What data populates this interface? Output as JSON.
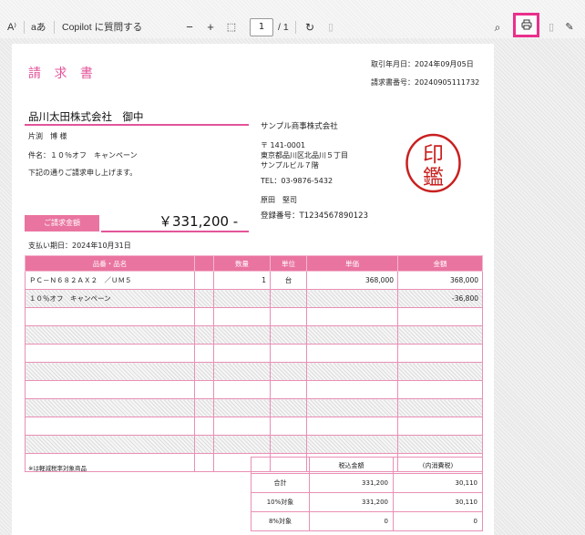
{
  "toolbar": {
    "read_aloud_icon": "A⁾",
    "text_label": "aあ",
    "copilot_label": "Copilot に質問する",
    "zoom_out": "−",
    "zoom_in": "+",
    "fit_icon": "⬚",
    "page_current": "1",
    "page_total": "/ 1",
    "rotate_icon": "↻",
    "search_icon": "⌕",
    "highlight_color": "#ea2f8c"
  },
  "invoice": {
    "title": "請 求 書",
    "issue_date": "取引年月日：2024年09月05日",
    "invoice_no": "請求書番号：20240905111732",
    "client_name": "品川太田株式会社　御中",
    "contact": "片渕　博 様",
    "subject": "件名：１０％オフ　キャンペーン",
    "request_text": "下記の通りご請求申し上げます。",
    "amount_label": "ご請求金額",
    "amount_value": "￥331,200 -",
    "due_date": "支払い期日：2024年10月31日",
    "seller": {
      "name": "サンプル商事株式会社",
      "postal": "〒 141-0001",
      "address1": "東京都品川区北品川５丁目",
      "address2": "サンプルビル７階",
      "tel": "TEL：03-9876-5432",
      "person": "原田　堅司",
      "reg_no": "登録番号：T1234567890123",
      "seal_text": "印鑑"
    },
    "table": {
      "headers": [
        "品番・品名",
        "",
        "数量",
        "単位",
        "単価",
        "金額"
      ],
      "rows": [
        [
          "ＰＣ－Ｎ６８２ＡＸ２　／ＵＭ５",
          "",
          "1",
          "台",
          "368,000",
          "368,000"
        ],
        [
          "１０％オフ　キャンペーン",
          "",
          "",
          "",
          "",
          "-36,800"
        ],
        [
          "",
          "",
          "",
          "",
          "",
          ""
        ],
        [
          "",
          "",
          "",
          "",
          "",
          ""
        ],
        [
          "",
          "",
          "",
          "",
          "",
          ""
        ],
        [
          "",
          "",
          "",
          "",
          "",
          ""
        ],
        [
          "",
          "",
          "",
          "",
          "",
          ""
        ],
        [
          "",
          "",
          "",
          "",
          "",
          ""
        ],
        [
          "",
          "",
          "",
          "",
          "",
          ""
        ],
        [
          "",
          "",
          "",
          "",
          "",
          ""
        ],
        [
          "",
          "",
          "",
          "",
          "",
          ""
        ]
      ]
    },
    "reduced_note": "※は軽減税率対象商品",
    "tax_table": {
      "headers": [
        "",
        "税込金額",
        "(内消費税)"
      ],
      "rows": [
        [
          "合計",
          "331,200",
          "30,110"
        ],
        [
          "10%対象",
          "331,200",
          "30,110"
        ],
        [
          "8%対象",
          "0",
          "0"
        ]
      ]
    },
    "accent_color": "#e2559a"
  }
}
